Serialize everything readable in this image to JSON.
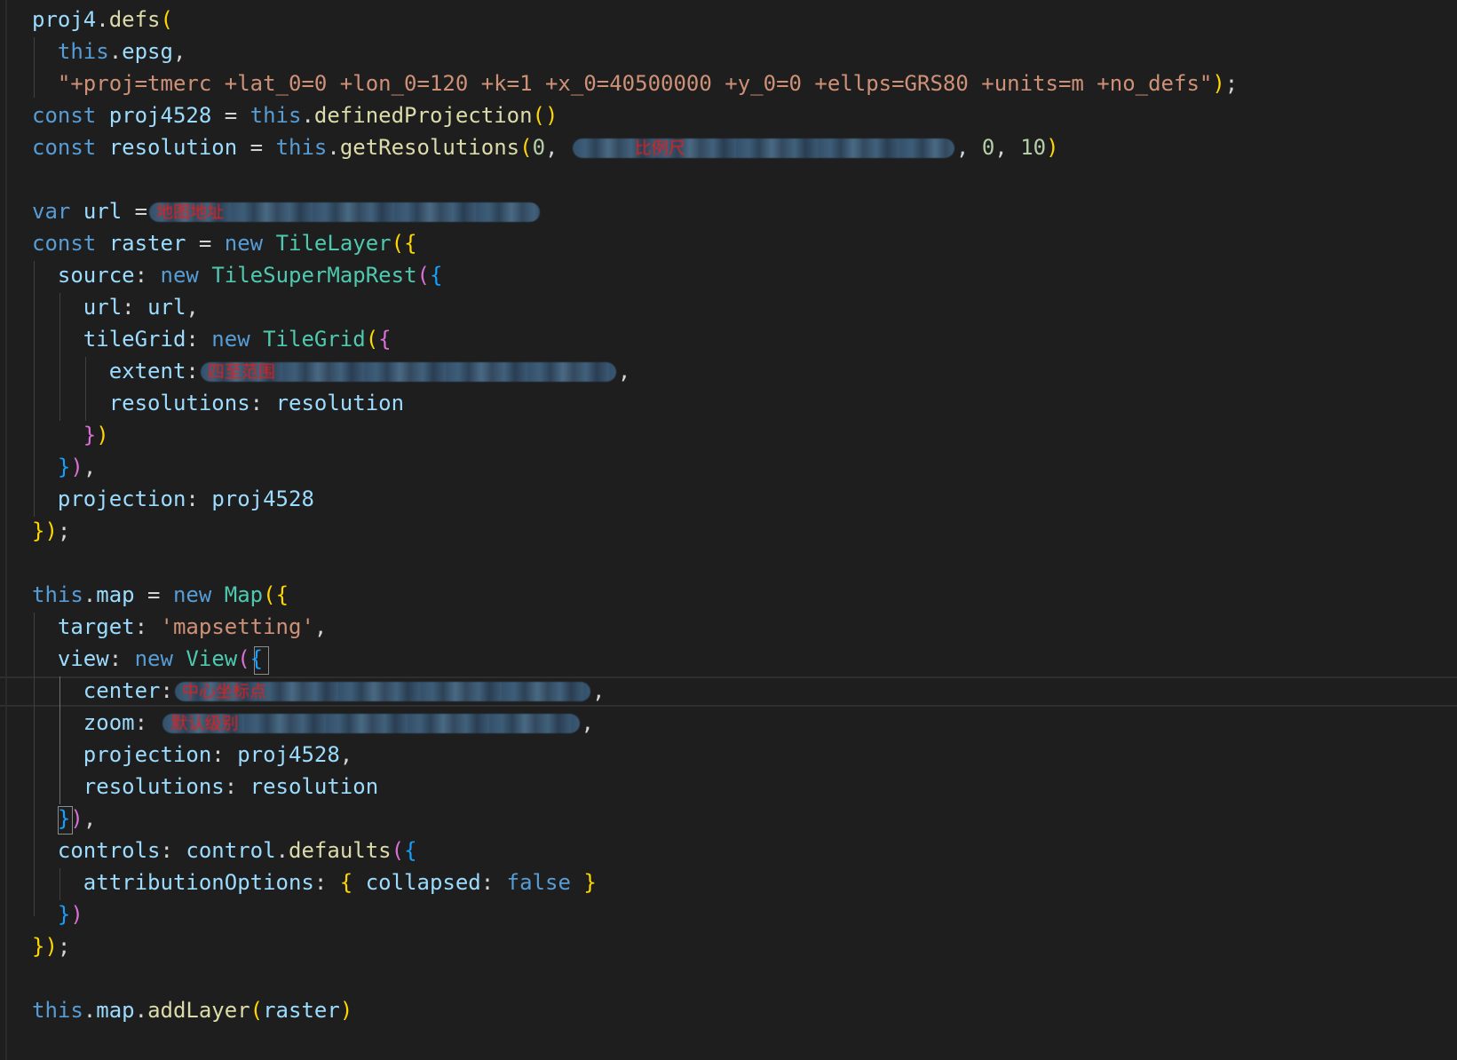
{
  "code": {
    "l1_ident": "proj4",
    "l1_method": "defs",
    "l2_this": "this",
    "l2_prop": "epsg",
    "l3_string": "\"+proj=tmerc +lat_0=0 +lon_0=120 +k=1 +x_0=40500000 +y_0=0 +ellps=GRS80 +units=m +no_defs\"",
    "kw_const": "const",
    "kw_var": "var",
    "kw_new": "new",
    "kw_this": "this",
    "kw_false": "false",
    "proj_const": "proj4528",
    "defined_projection": "definedProjection",
    "resolution_const": "resolution",
    "get_resolutions": "getResolutions",
    "num_0": "0",
    "num_10": "10",
    "url_var": "url",
    "raster_const": "raster",
    "tile_layer": "TileLayer",
    "source_key": "source",
    "tile_supermap_rest": "TileSuperMapRest",
    "url_key": "url",
    "tile_grid_key": "tileGrid",
    "tile_grid_class": "TileGrid",
    "extent_key": "extent",
    "resolutions_key": "resolutions",
    "projection_key": "projection",
    "map_prop": "map",
    "map_class": "Map",
    "target_key": "target",
    "target_value": "'mapsetting'",
    "view_key": "view",
    "view_class": "View",
    "center_key": "center",
    "zoom_key": "zoom",
    "controls_key": "controls",
    "control_obj": "control",
    "defaults_fn": "defaults",
    "attribution_key": "attributionOptions",
    "collapsed_key": "collapsed",
    "add_layer": "addLayer"
  },
  "annotations": {
    "scale": "比例尺",
    "map_url": "地图地址",
    "extent": "四至范围",
    "center": "中心坐标点",
    "zoom": "默认级别"
  },
  "theme": {
    "background": "#1e1e1e",
    "keyword": "#569cd6",
    "variable": "#9cdcfe",
    "function": "#dcdcaa",
    "string": "#ce9178",
    "number": "#b5cea8",
    "class": "#4ec9b0",
    "bracket_level1": "#ffd700",
    "bracket_level2": "#da70d6",
    "bracket_level3": "#179fff",
    "annotation": "#e02020"
  }
}
